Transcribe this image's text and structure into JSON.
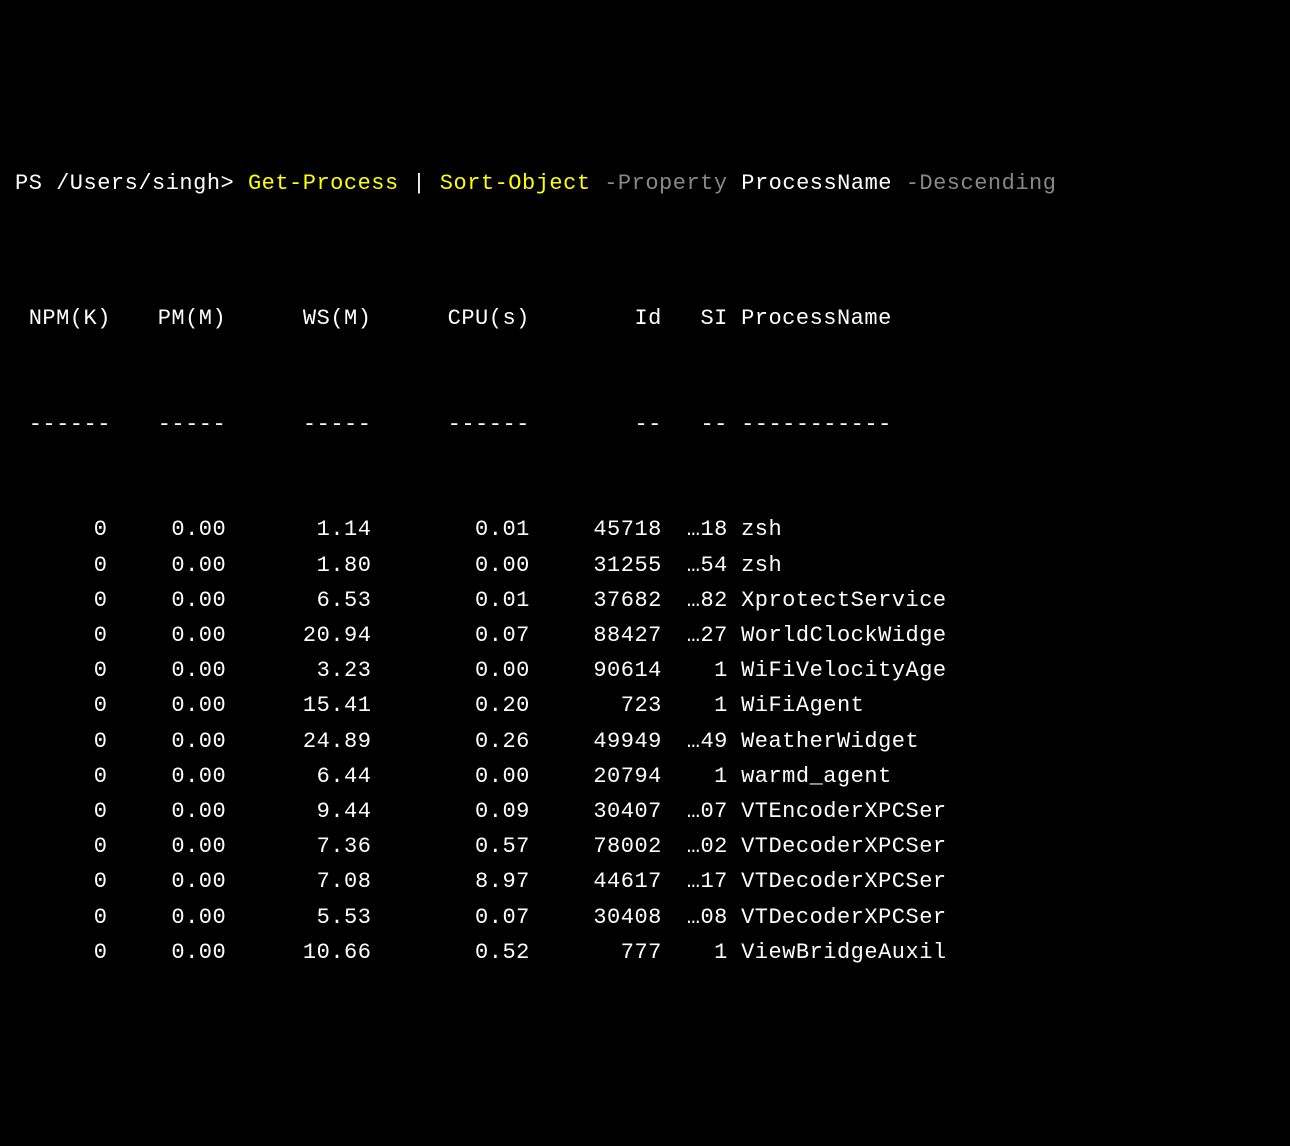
{
  "prompt": {
    "ps": "PS ",
    "path": "/Users/singh",
    "sep": "> ",
    "cmd1": "Get-Process",
    "pipe": " | ",
    "cmd2": "Sort-Object",
    "param1": " -Property ",
    "val1": "ProcessName",
    "param2": " -Descending"
  },
  "headers": {
    "npm": " NPM(K)",
    "pm": "PM(M)",
    "ws": "WS(M)",
    "cpu": "CPU(s)",
    "id": "Id",
    "si": "SI",
    "name": "ProcessName"
  },
  "dividers": {
    "npm": " ------",
    "pm": "-----",
    "ws": "-----",
    "cpu": "------",
    "id": "--",
    "si": "--",
    "name": "-----------"
  },
  "rows": [
    {
      "npm": "0",
      "pm": "0.00",
      "ws": "1.14",
      "cpu": "0.01",
      "id": "45718",
      "si": "…18",
      "name": "zsh"
    },
    {
      "npm": "0",
      "pm": "0.00",
      "ws": "1.80",
      "cpu": "0.00",
      "id": "31255",
      "si": "…54",
      "name": "zsh"
    },
    {
      "npm": "0",
      "pm": "0.00",
      "ws": "6.53",
      "cpu": "0.01",
      "id": "37682",
      "si": "…82",
      "name": "XprotectService"
    },
    {
      "npm": "0",
      "pm": "0.00",
      "ws": "20.94",
      "cpu": "0.07",
      "id": "88427",
      "si": "…27",
      "name": "WorldClockWidge"
    },
    {
      "npm": "0",
      "pm": "0.00",
      "ws": "3.23",
      "cpu": "0.00",
      "id": "90614",
      "si": "1",
      "name": "WiFiVelocityAge"
    },
    {
      "npm": "0",
      "pm": "0.00",
      "ws": "15.41",
      "cpu": "0.20",
      "id": "723",
      "si": "1",
      "name": "WiFiAgent"
    },
    {
      "npm": "0",
      "pm": "0.00",
      "ws": "24.89",
      "cpu": "0.26",
      "id": "49949",
      "si": "…49",
      "name": "WeatherWidget"
    },
    {
      "npm": "0",
      "pm": "0.00",
      "ws": "6.44",
      "cpu": "0.00",
      "id": "20794",
      "si": "1",
      "name": "warmd_agent"
    },
    {
      "npm": "0",
      "pm": "0.00",
      "ws": "9.44",
      "cpu": "0.09",
      "id": "30407",
      "si": "…07",
      "name": "VTEncoderXPCSer"
    },
    {
      "npm": "0",
      "pm": "0.00",
      "ws": "7.36",
      "cpu": "0.57",
      "id": "78002",
      "si": "…02",
      "name": "VTDecoderXPCSer"
    },
    {
      "npm": "0",
      "pm": "0.00",
      "ws": "7.08",
      "cpu": "8.97",
      "id": "44617",
      "si": "…17",
      "name": "VTDecoderXPCSer"
    },
    {
      "npm": "0",
      "pm": "0.00",
      "ws": "5.53",
      "cpu": "0.07",
      "id": "30408",
      "si": "…08",
      "name": "VTDecoderXPCSer"
    },
    {
      "npm": "0",
      "pm": "0.00",
      "ws": "10.66",
      "cpu": "0.52",
      "id": "777",
      "si": "1",
      "name": "ViewBridgeAuxil"
    }
  ]
}
